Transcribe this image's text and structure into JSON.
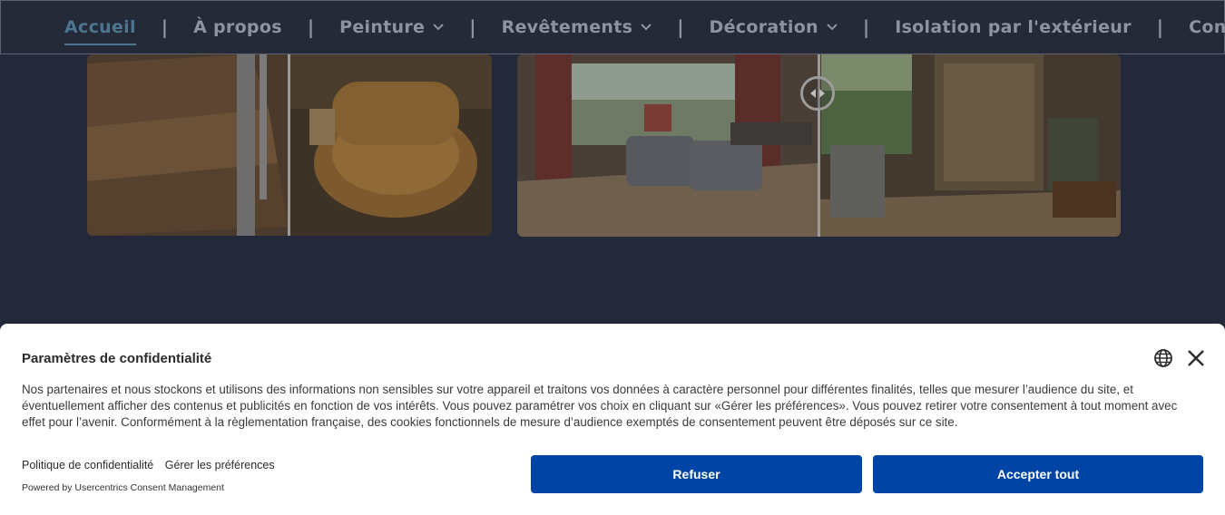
{
  "nav": {
    "items": [
      {
        "label": "Accueil",
        "active": true,
        "dropdown": false
      },
      {
        "label": "À propos",
        "active": false,
        "dropdown": false
      },
      {
        "label": "Peinture",
        "active": false,
        "dropdown": true
      },
      {
        "label": "Revêtements",
        "active": false,
        "dropdown": true
      },
      {
        "label": "Décoration",
        "active": false,
        "dropdown": true
      },
      {
        "label": "Isolation par l'extérieur",
        "active": false,
        "dropdown": false
      },
      {
        "label": "Contact",
        "active": false,
        "dropdown": false
      }
    ],
    "separator": "|",
    "active_color": "#4d7590",
    "text_color": "#8d939f"
  },
  "gallery": {
    "images": [
      {
        "alt": "staircase-and-wicker-chair-comparison",
        "icon": "before-after-slider"
      },
      {
        "alt": "living-room-comparison",
        "icon": "before-after-slider"
      }
    ]
  },
  "consent": {
    "title": "Paramètres de confidentialité",
    "text": "Nos partenaires et nous stockons et utilisons des informations non sensibles sur votre appareil et traitons vos données à caractère personnel pour différentes finalités, telles que mesurer l’audience du site, et éventuellement afficher des contenus et publicités en fonction de vos intérêts. Vous pouvez paramétrer vos choix en cliquant sur «Gérer les préférences». Vous pouvez retirer votre consentement à tout moment avec effet pour l’avenir. Conformément à la règlementation française, des cookies fonctionnels de mesure d’audience exemptés de consentement peuvent être déposés sur ce site.",
    "privacy_link": "Politique de confidentialité",
    "manage_link": "Gérer les préférences",
    "powered_by": "Powered by Usercentrics Consent Management",
    "refuse_label": "Refuser",
    "accept_label": "Accepter tout",
    "button_color": "#0045a5",
    "icons": [
      "globe-icon",
      "close-icon"
    ]
  }
}
